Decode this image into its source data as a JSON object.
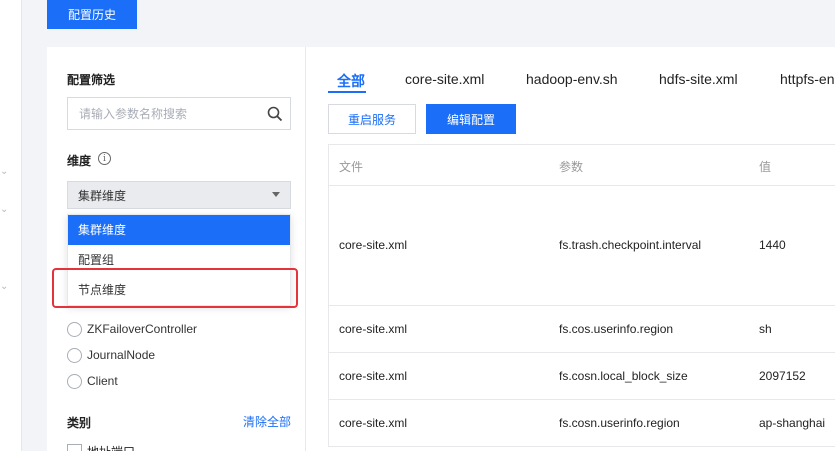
{
  "header": {
    "history_button": "配置历史"
  },
  "filter": {
    "title": "配置筛选",
    "search_placeholder": "请输入参数名称搜索",
    "dimension_label": "维度",
    "dimension_selected": "集群维度",
    "dimension_options": [
      "集群维度",
      "配置组",
      "节点维度"
    ],
    "radios": [
      "ZKFailoverController",
      "JournalNode",
      "Client"
    ],
    "category_label": "类别",
    "clear_all": "清除全部",
    "checkbox_partial": "地址端口"
  },
  "tabs": [
    "全部",
    "core-site.xml",
    "hadoop-env.sh",
    "hdfs-site.xml",
    "httpfs-en"
  ],
  "actions": {
    "restart": "重启服务",
    "edit": "编辑配置"
  },
  "table": {
    "columns": [
      "文件",
      "参数",
      "值"
    ],
    "rows": [
      {
        "file": "core-site.xml",
        "param": "fs.trash.checkpoint.interval",
        "value": "1440"
      },
      {
        "file": "core-site.xml",
        "param": "fs.cos.userinfo.region",
        "value": "sh"
      },
      {
        "file": "core-site.xml",
        "param": "fs.cosn.local_block_size",
        "value": "2097152"
      },
      {
        "file": "core-site.xml",
        "param": "fs.cosn.userinfo.region",
        "value": "ap-shanghai"
      }
    ]
  },
  "colors": {
    "accent": "#1a6ef7",
    "highlight": "#e5333c"
  }
}
